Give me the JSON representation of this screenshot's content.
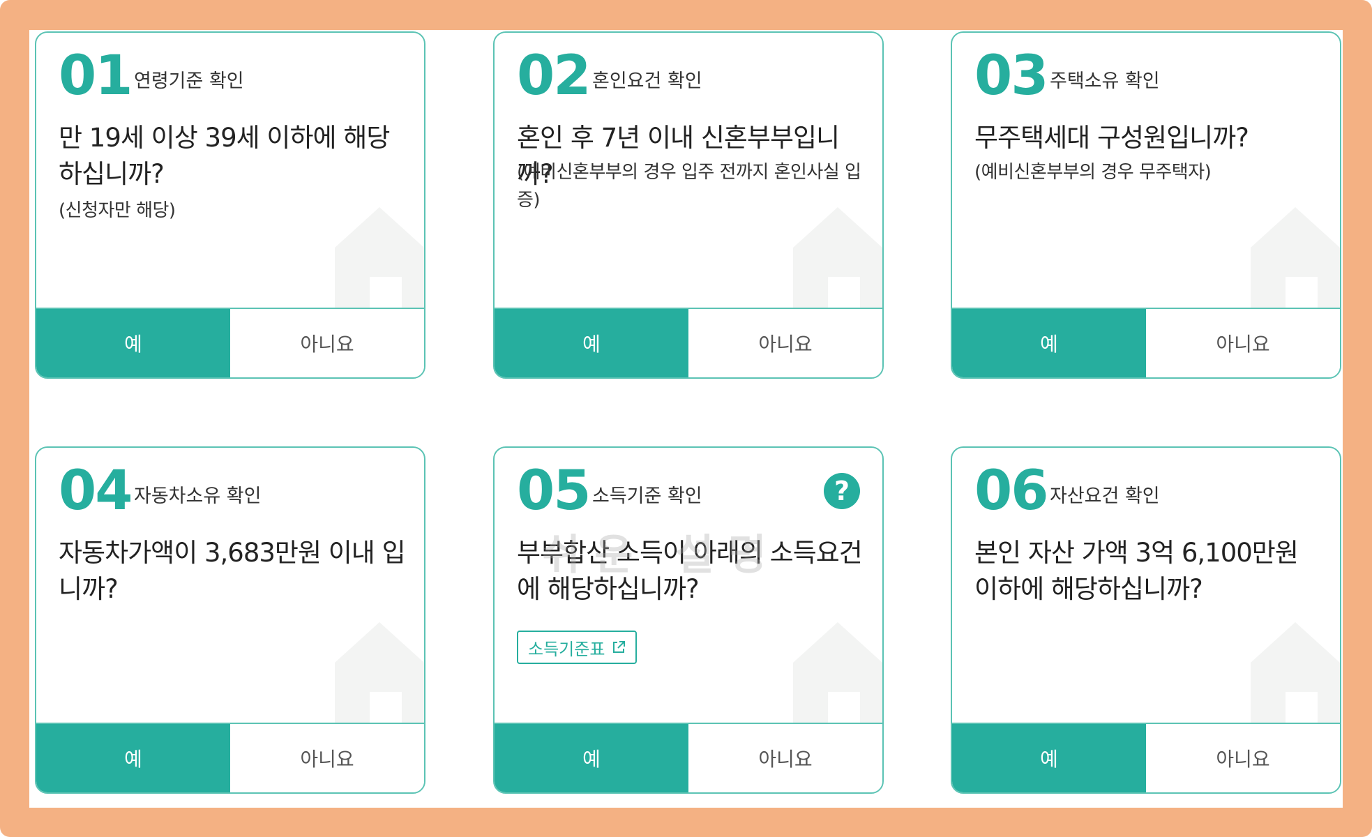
{
  "cards": [
    {
      "num": "01",
      "label": "연령기준 확인",
      "question": "만 19세 이상 39세 이하에 해당하십니까?",
      "note": "(신청자만 해당)",
      "yes": "예",
      "no": "아니요"
    },
    {
      "num": "02",
      "label": "혼인요건 확인",
      "question": "혼인 후 7년 이내 신혼부부입니까?",
      "note": "(예비신혼부부의 경우 입주 전까지 혼인사실 입증)",
      "yes": "예",
      "no": "아니요"
    },
    {
      "num": "03",
      "label": "주택소유 확인",
      "question": "무주택세대 구성원입니까?",
      "note": "(예비신혼부부의 경우 무주택자)",
      "yes": "예",
      "no": "아니요"
    },
    {
      "num": "04",
      "label": "자동차소유 확인",
      "question": "자동차가액이 3,683만원 이내 입니까?",
      "yes": "예",
      "no": "아니요"
    },
    {
      "num": "05",
      "label": "소득기준 확인",
      "question": "부부합산 소득이 아래의 소득요건에 해당하십니까?",
      "help_icon": "question-circle-icon",
      "watermark": "쉬운 설명",
      "link_label": "소득기준표",
      "yes": "예",
      "no": "아니요"
    },
    {
      "num": "06",
      "label": "자산요건 확인",
      "question": "본인 자산 가액 3억 6,100만원 이하에 해당하십니까?",
      "yes": "예",
      "no": "아니요"
    }
  ],
  "colors": {
    "accent": "#26ae9e",
    "border": "#5bc3b4",
    "frame": "#f4b183"
  }
}
